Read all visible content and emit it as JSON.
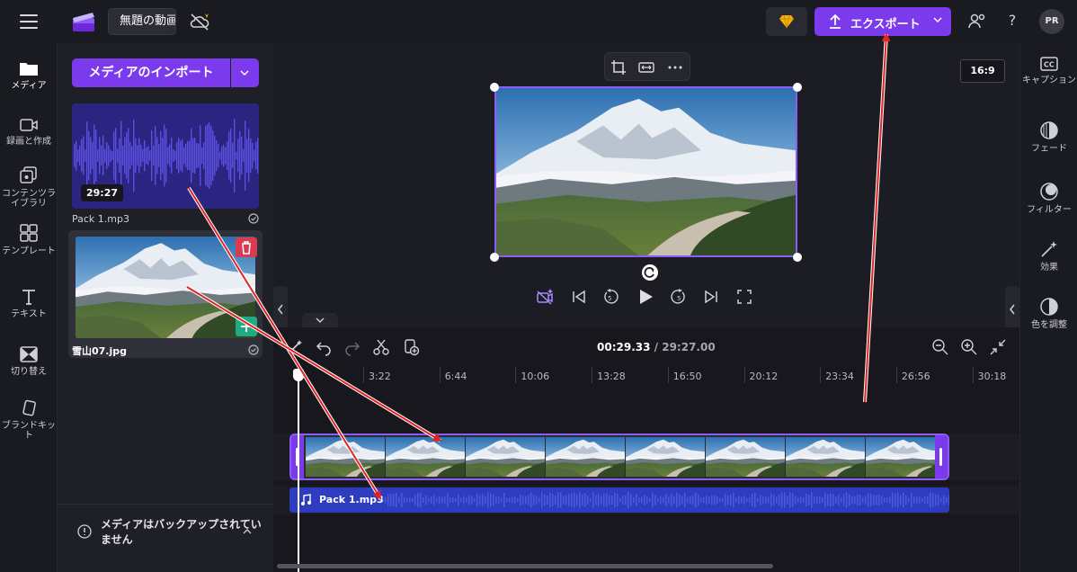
{
  "topbar": {
    "project_title": "無題の動画",
    "export_label": "エクスポート",
    "help_label": "?",
    "avatar_initials": "PR"
  },
  "left_rail": {
    "items": [
      {
        "label": "メディア",
        "icon": "media-folder-icon"
      },
      {
        "label": "録画と作成",
        "icon": "video-camera-icon"
      },
      {
        "label": "コンテンツライブラリ",
        "icon": "content-library-icon"
      },
      {
        "label": "テンプレート",
        "icon": "templates-icon"
      },
      {
        "label": "テキスト",
        "icon": "text-icon"
      },
      {
        "label": "切り替え",
        "icon": "transitions-icon"
      },
      {
        "label": "ブランドキット",
        "icon": "brand-kit-icon"
      }
    ]
  },
  "media_panel": {
    "import_label": "メディアのインポート",
    "assets": [
      {
        "name": "Pack 1.mp3",
        "duration": "29:27",
        "type": "audio"
      },
      {
        "name": "雪山07.jpg",
        "type": "image"
      }
    ],
    "backup_notice": "メディアはバックアップされていません"
  },
  "preview": {
    "aspect_ratio": "16:9"
  },
  "timeline": {
    "current_time": "00:29.33",
    "total_time": "/ 29:27.00",
    "ruler_labels": [
      "3:22",
      "6:44",
      "10:06",
      "13:28",
      "16:50",
      "20:12",
      "23:34",
      "26:56",
      "30:18"
    ],
    "audio_track_label": "Pack 1.mp3"
  },
  "right_rail": {
    "items": [
      {
        "label": "キャプション",
        "icon": "captions-icon"
      },
      {
        "label": "フェード",
        "icon": "fade-icon"
      },
      {
        "label": "フィルター",
        "icon": "filters-icon"
      },
      {
        "label": "効果",
        "icon": "effects-icon"
      },
      {
        "label": "色を調整",
        "icon": "adjust-colors-icon"
      }
    ]
  },
  "colors": {
    "accent": "#7c3aed",
    "accent_border": "#8b5cf6",
    "audio_track": "#2e3cc0",
    "annotation_arrow": "#e02424"
  }
}
